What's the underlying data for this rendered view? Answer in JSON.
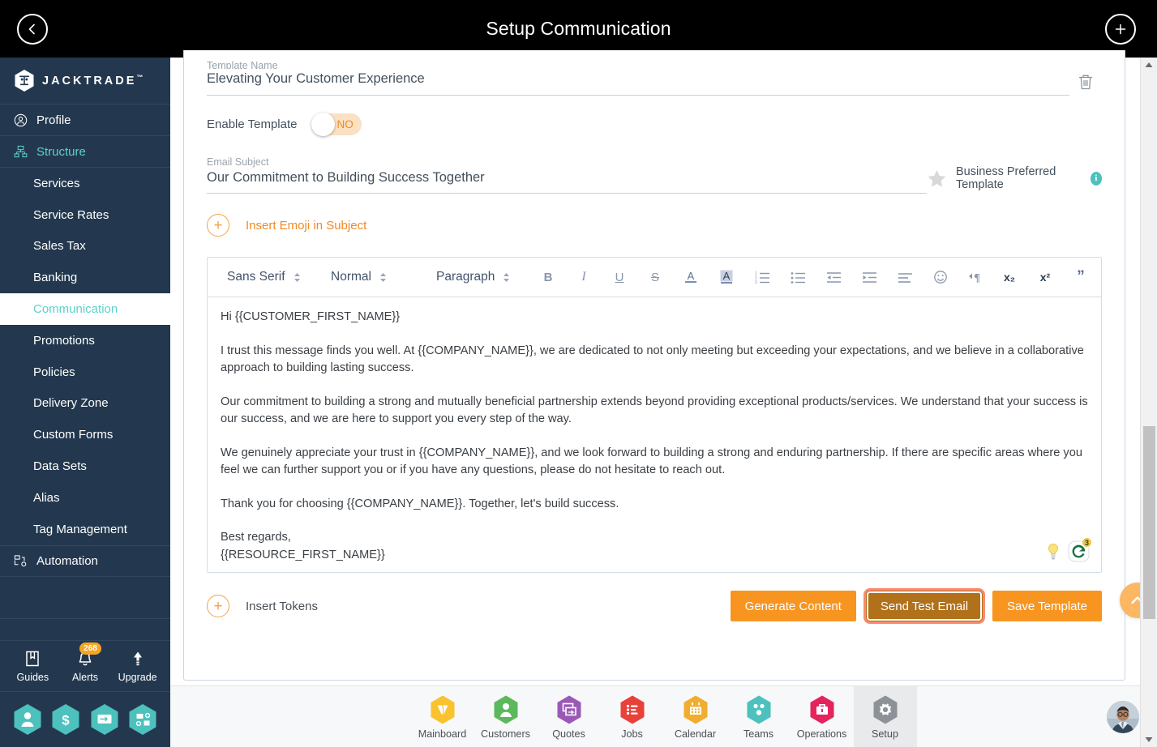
{
  "header": {
    "title": "Setup Communication",
    "back_icon": "chevron-left-icon",
    "add_icon": "plus-icon"
  },
  "sidebar": {
    "brand": {
      "name": "JACKTRADE",
      "tm": "™"
    },
    "items": [
      {
        "label": "Profile",
        "icon": "user-circle-icon",
        "type": "group",
        "active": false
      },
      {
        "label": "Structure",
        "icon": "structure-icon",
        "type": "group",
        "active": true
      }
    ],
    "structure_children": [
      {
        "label": "Services",
        "selected": false
      },
      {
        "label": "Service Rates",
        "selected": false
      },
      {
        "label": "Sales Tax",
        "selected": false
      },
      {
        "label": "Banking",
        "selected": false
      },
      {
        "label": "Communication",
        "selected": true
      },
      {
        "label": "Promotions",
        "selected": false
      },
      {
        "label": "Policies",
        "selected": false
      },
      {
        "label": "Delivery Zone",
        "selected": false
      },
      {
        "label": "Custom Forms",
        "selected": false
      },
      {
        "label": "Data Sets",
        "selected": false
      },
      {
        "label": "Alias",
        "selected": false
      },
      {
        "label": "Tag Management",
        "selected": false
      }
    ],
    "automation": {
      "label": "Automation",
      "icon": "automation-icon"
    },
    "utilities": [
      {
        "label": "Guides",
        "icon": "book-icon",
        "badge": ""
      },
      {
        "label": "Alerts",
        "icon": "bell-icon",
        "badge": "268"
      },
      {
        "label": "Upgrade",
        "icon": "arrow-up-icon",
        "badge": ""
      }
    ],
    "quick_hex": [
      {
        "icon": "person-hex-icon"
      },
      {
        "icon": "dollar-hex-icon"
      },
      {
        "icon": "payment-hex-icon"
      },
      {
        "icon": "workflow-hex-icon"
      }
    ],
    "colors": {
      "background": "#23384e",
      "accent": "#5fd0c8",
      "badge": "#f5a623",
      "hex": "#4cc1bd"
    }
  },
  "form": {
    "template_name": {
      "label": "Template Name",
      "value": "Elevating Your Customer Experience"
    },
    "delete_icon": "trash-icon",
    "enable_template": {
      "label": "Enable Template",
      "state": "NO"
    },
    "email_subject": {
      "label": "Email Subject",
      "value": "Our Commitment to Building Success Together"
    },
    "preferred": {
      "star_icon": "star-icon",
      "label": "Business Preferred Template",
      "info": "i"
    },
    "insert_emoji": {
      "label": "Insert Emoji in Subject",
      "icon": "plus-circle-icon"
    },
    "insert_tokens": {
      "label": "Insert Tokens",
      "icon": "plus-circle-icon"
    }
  },
  "editor": {
    "toolbar": {
      "font_family": "Sans Serif",
      "font_size": "Normal",
      "block_format": "Paragraph",
      "buttons": [
        {
          "name": "bold-icon",
          "glyph": "B"
        },
        {
          "name": "italic-icon",
          "glyph": "I"
        },
        {
          "name": "underline-icon",
          "glyph": "U"
        },
        {
          "name": "strikethrough-icon",
          "glyph": "S"
        },
        {
          "name": "text-color-icon",
          "glyph": "A"
        },
        {
          "name": "background-color-icon",
          "glyph": "A"
        },
        {
          "name": "ordered-list-icon",
          "glyph": ""
        },
        {
          "name": "bullet-list-icon",
          "glyph": ""
        },
        {
          "name": "outdent-icon",
          "glyph": ""
        },
        {
          "name": "indent-icon",
          "glyph": ""
        },
        {
          "name": "align-icon",
          "glyph": ""
        },
        {
          "name": "emoji-icon",
          "glyph": ""
        },
        {
          "name": "text-direction-icon",
          "glyph": ""
        },
        {
          "name": "subscript-icon",
          "glyph": "x₂"
        },
        {
          "name": "superscript-icon",
          "glyph": "x²"
        },
        {
          "name": "blockquote-icon",
          "glyph": "”"
        },
        {
          "name": "code-block-icon",
          "glyph": "</>"
        },
        {
          "name": "link-icon",
          "glyph": ""
        }
      ]
    },
    "body": [
      "Hi {{CUSTOMER_FIRST_NAME}}",
      "I trust this message finds you well. At {{COMPANY_NAME}}, we are dedicated to not only meeting but exceeding your expectations, and we believe in a collaborative approach to building lasting success.",
      "Our commitment to building a strong and mutually beneficial partnership extends beyond providing exceptional products/services. We understand that your success is our success, and we are here to support you every step of the way.",
      "We genuinely appreciate your trust in {{COMPANY_NAME}}, and we look forward to building a strong and enduring partnership. If there are specific areas where you feel we can further support you or if you have any questions, please do not hesitate to reach out.",
      "Thank you for choosing {{COMPANY_NAME}}. Together, let's build success."
    ],
    "signature_line1": "Best regards,",
    "signature_line2": "{{RESOURCE_FIRST_NAME}}",
    "assist": {
      "bulb_icon": "lightbulb-icon",
      "grammarly_icon": "grammarly-icon",
      "grammarly_count": "3"
    }
  },
  "actions": {
    "generate_content": "Generate Content",
    "send_test_email": "Send Test Email",
    "save_template": "Save Template",
    "focused": "Send Test Email",
    "button_color": "#f79520",
    "focus_ring_color": "#fa8a6e"
  },
  "scroll_top_button": {
    "icon": "chevron-up-icon",
    "color": "#fbb763"
  },
  "bottom_nav": {
    "items": [
      {
        "label": "Mainboard",
        "icon": "mainboard-hex-icon",
        "color": "#f9c22e",
        "active": false
      },
      {
        "label": "Customers",
        "icon": "customers-hex-icon",
        "color": "#5cb85c",
        "active": false
      },
      {
        "label": "Quotes",
        "icon": "quotes-hex-icon",
        "color": "#9b59b6",
        "active": false
      },
      {
        "label": "Jobs",
        "icon": "jobs-hex-icon",
        "color": "#e8413a",
        "active": false
      },
      {
        "label": "Calendar",
        "icon": "calendar-hex-icon",
        "color": "#f0ad2e",
        "active": false
      },
      {
        "label": "Teams",
        "icon": "teams-hex-icon",
        "color": "#4cc1bd",
        "active": false
      },
      {
        "label": "Operations",
        "icon": "operations-hex-icon",
        "color": "#e5245e",
        "active": false
      },
      {
        "label": "Setup",
        "icon": "setup-hex-icon",
        "color": "#8d9298",
        "active": true
      }
    ],
    "avatar": "user-avatar"
  },
  "scrollbar": {
    "up_arrow": "scroll-up-arrow",
    "down_arrow": "scroll-down-arrow"
  }
}
